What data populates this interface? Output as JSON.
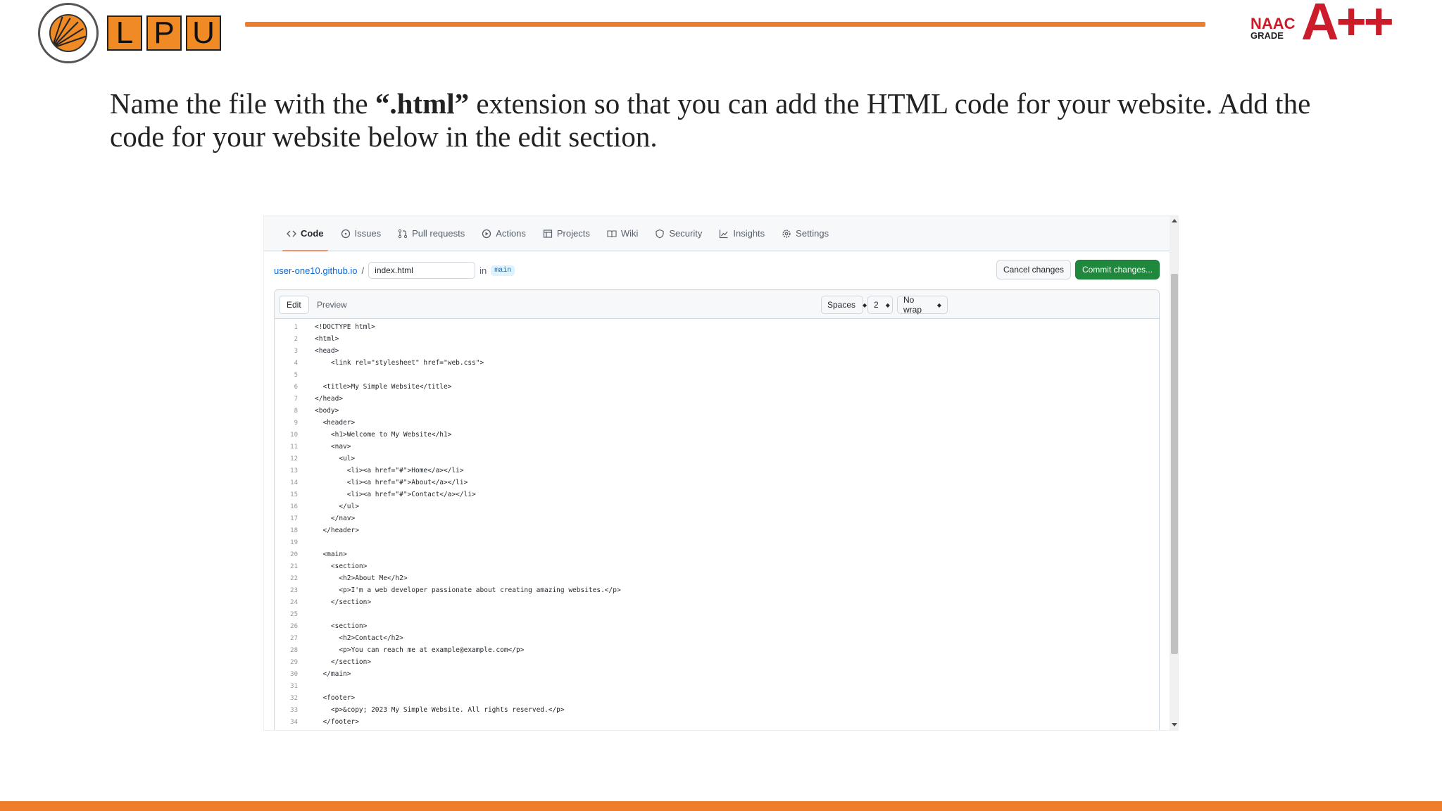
{
  "slide": {
    "logo_letters": [
      "L",
      "P",
      "U"
    ],
    "naac_label": "NAAC",
    "grade_label": "GRADE",
    "grade": "A++",
    "text_before": "Name the file with the ",
    "text_bold": "“.html”",
    "text_after": " extension so that you can add the HTML code for your website. Add the code for your website below in the edit section.",
    "colors": {
      "accent": "#ee7d2c",
      "naac": "#cc1b2a"
    }
  },
  "github": {
    "tabs": [
      {
        "label": "Code",
        "icon": "code-icon"
      },
      {
        "label": "Issues",
        "icon": "issue-icon"
      },
      {
        "label": "Pull requests",
        "icon": "pull-request-icon"
      },
      {
        "label": "Actions",
        "icon": "play-icon"
      },
      {
        "label": "Projects",
        "icon": "table-icon"
      },
      {
        "label": "Wiki",
        "icon": "book-icon"
      },
      {
        "label": "Security",
        "icon": "shield-icon"
      },
      {
        "label": "Insights",
        "icon": "graph-icon"
      },
      {
        "label": "Settings",
        "icon": "gear-icon"
      }
    ],
    "repo": "user-one10.github.io",
    "separator": "/",
    "filename": "index.html",
    "in_label": "in",
    "branch": "main",
    "cancel_label": "Cancel changes",
    "commit_label": "Commit changes...",
    "edit_label": "Edit",
    "preview_label": "Preview",
    "indent_mode": "Spaces",
    "indent_size": "2",
    "wrap_mode": "No wrap",
    "colors": {
      "commit": "#1f883d",
      "link": "#0969da",
      "tab_underline": "#fd8c73"
    },
    "code_lines": [
      "<!DOCTYPE html>",
      "<html>",
      "<head>",
      "    <link rel=\"stylesheet\" href=\"web.css\">",
      "",
      "  <title>My Simple Website</title>",
      "</head>",
      "<body>",
      "  <header>",
      "    <h1>Welcome to My Website</h1>",
      "    <nav>",
      "      <ul>",
      "        <li><a href=\"#\">Home</a></li>",
      "        <li><a href=\"#\">About</a></li>",
      "        <li><a href=\"#\">Contact</a></li>",
      "      </ul>",
      "    </nav>",
      "  </header>",
      "",
      "  <main>",
      "    <section>",
      "      <h2>About Me</h2>",
      "      <p>I'm a web developer passionate about creating amazing websites.</p>",
      "    </section>",
      "",
      "    <section>",
      "      <h2>Contact</h2>",
      "      <p>You can reach me at example@example.com</p>",
      "    </section>",
      "  </main>",
      "",
      "  <footer>",
      "    <p>&copy; 2023 My Simple Website. All rights reserved.</p>",
      "  </footer>"
    ]
  }
}
